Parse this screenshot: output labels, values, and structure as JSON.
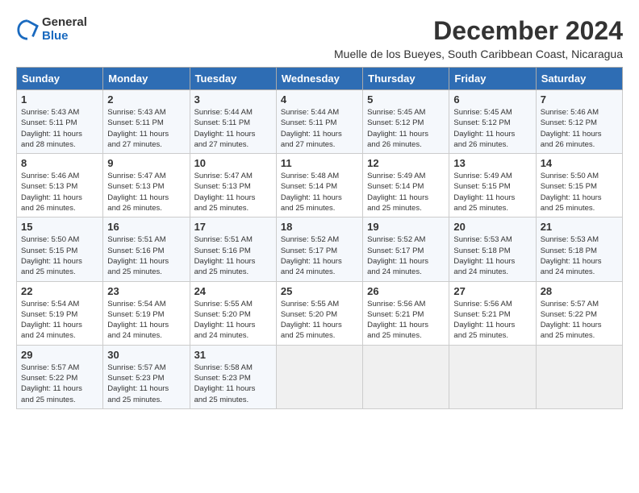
{
  "header": {
    "logo_general": "General",
    "logo_blue": "Blue",
    "month_title": "December 2024",
    "location": "Muelle de los Bueyes, South Caribbean Coast, Nicaragua"
  },
  "days_of_week": [
    "Sunday",
    "Monday",
    "Tuesday",
    "Wednesday",
    "Thursday",
    "Friday",
    "Saturday"
  ],
  "weeks": [
    [
      {
        "day": "1",
        "info": "Sunrise: 5:43 AM\nSunset: 5:11 PM\nDaylight: 11 hours\nand 28 minutes."
      },
      {
        "day": "2",
        "info": "Sunrise: 5:43 AM\nSunset: 5:11 PM\nDaylight: 11 hours\nand 27 minutes."
      },
      {
        "day": "3",
        "info": "Sunrise: 5:44 AM\nSunset: 5:11 PM\nDaylight: 11 hours\nand 27 minutes."
      },
      {
        "day": "4",
        "info": "Sunrise: 5:44 AM\nSunset: 5:11 PM\nDaylight: 11 hours\nand 27 minutes."
      },
      {
        "day": "5",
        "info": "Sunrise: 5:45 AM\nSunset: 5:12 PM\nDaylight: 11 hours\nand 26 minutes."
      },
      {
        "day": "6",
        "info": "Sunrise: 5:45 AM\nSunset: 5:12 PM\nDaylight: 11 hours\nand 26 minutes."
      },
      {
        "day": "7",
        "info": "Sunrise: 5:46 AM\nSunset: 5:12 PM\nDaylight: 11 hours\nand 26 minutes."
      }
    ],
    [
      {
        "day": "8",
        "info": "Sunrise: 5:46 AM\nSunset: 5:13 PM\nDaylight: 11 hours\nand 26 minutes."
      },
      {
        "day": "9",
        "info": "Sunrise: 5:47 AM\nSunset: 5:13 PM\nDaylight: 11 hours\nand 26 minutes."
      },
      {
        "day": "10",
        "info": "Sunrise: 5:47 AM\nSunset: 5:13 PM\nDaylight: 11 hours\nand 25 minutes."
      },
      {
        "day": "11",
        "info": "Sunrise: 5:48 AM\nSunset: 5:14 PM\nDaylight: 11 hours\nand 25 minutes."
      },
      {
        "day": "12",
        "info": "Sunrise: 5:49 AM\nSunset: 5:14 PM\nDaylight: 11 hours\nand 25 minutes."
      },
      {
        "day": "13",
        "info": "Sunrise: 5:49 AM\nSunset: 5:15 PM\nDaylight: 11 hours\nand 25 minutes."
      },
      {
        "day": "14",
        "info": "Sunrise: 5:50 AM\nSunset: 5:15 PM\nDaylight: 11 hours\nand 25 minutes."
      }
    ],
    [
      {
        "day": "15",
        "info": "Sunrise: 5:50 AM\nSunset: 5:15 PM\nDaylight: 11 hours\nand 25 minutes."
      },
      {
        "day": "16",
        "info": "Sunrise: 5:51 AM\nSunset: 5:16 PM\nDaylight: 11 hours\nand 25 minutes."
      },
      {
        "day": "17",
        "info": "Sunrise: 5:51 AM\nSunset: 5:16 PM\nDaylight: 11 hours\nand 25 minutes."
      },
      {
        "day": "18",
        "info": "Sunrise: 5:52 AM\nSunset: 5:17 PM\nDaylight: 11 hours\nand 24 minutes."
      },
      {
        "day": "19",
        "info": "Sunrise: 5:52 AM\nSunset: 5:17 PM\nDaylight: 11 hours\nand 24 minutes."
      },
      {
        "day": "20",
        "info": "Sunrise: 5:53 AM\nSunset: 5:18 PM\nDaylight: 11 hours\nand 24 minutes."
      },
      {
        "day": "21",
        "info": "Sunrise: 5:53 AM\nSunset: 5:18 PM\nDaylight: 11 hours\nand 24 minutes."
      }
    ],
    [
      {
        "day": "22",
        "info": "Sunrise: 5:54 AM\nSunset: 5:19 PM\nDaylight: 11 hours\nand 24 minutes."
      },
      {
        "day": "23",
        "info": "Sunrise: 5:54 AM\nSunset: 5:19 PM\nDaylight: 11 hours\nand 24 minutes."
      },
      {
        "day": "24",
        "info": "Sunrise: 5:55 AM\nSunset: 5:20 PM\nDaylight: 11 hours\nand 24 minutes."
      },
      {
        "day": "25",
        "info": "Sunrise: 5:55 AM\nSunset: 5:20 PM\nDaylight: 11 hours\nand 25 minutes."
      },
      {
        "day": "26",
        "info": "Sunrise: 5:56 AM\nSunset: 5:21 PM\nDaylight: 11 hours\nand 25 minutes."
      },
      {
        "day": "27",
        "info": "Sunrise: 5:56 AM\nSunset: 5:21 PM\nDaylight: 11 hours\nand 25 minutes."
      },
      {
        "day": "28",
        "info": "Sunrise: 5:57 AM\nSunset: 5:22 PM\nDaylight: 11 hours\nand 25 minutes."
      }
    ],
    [
      {
        "day": "29",
        "info": "Sunrise: 5:57 AM\nSunset: 5:22 PM\nDaylight: 11 hours\nand 25 minutes."
      },
      {
        "day": "30",
        "info": "Sunrise: 5:57 AM\nSunset: 5:23 PM\nDaylight: 11 hours\nand 25 minutes."
      },
      {
        "day": "31",
        "info": "Sunrise: 5:58 AM\nSunset: 5:23 PM\nDaylight: 11 hours\nand 25 minutes."
      },
      {
        "day": "",
        "info": ""
      },
      {
        "day": "",
        "info": ""
      },
      {
        "day": "",
        "info": ""
      },
      {
        "day": "",
        "info": ""
      }
    ]
  ]
}
